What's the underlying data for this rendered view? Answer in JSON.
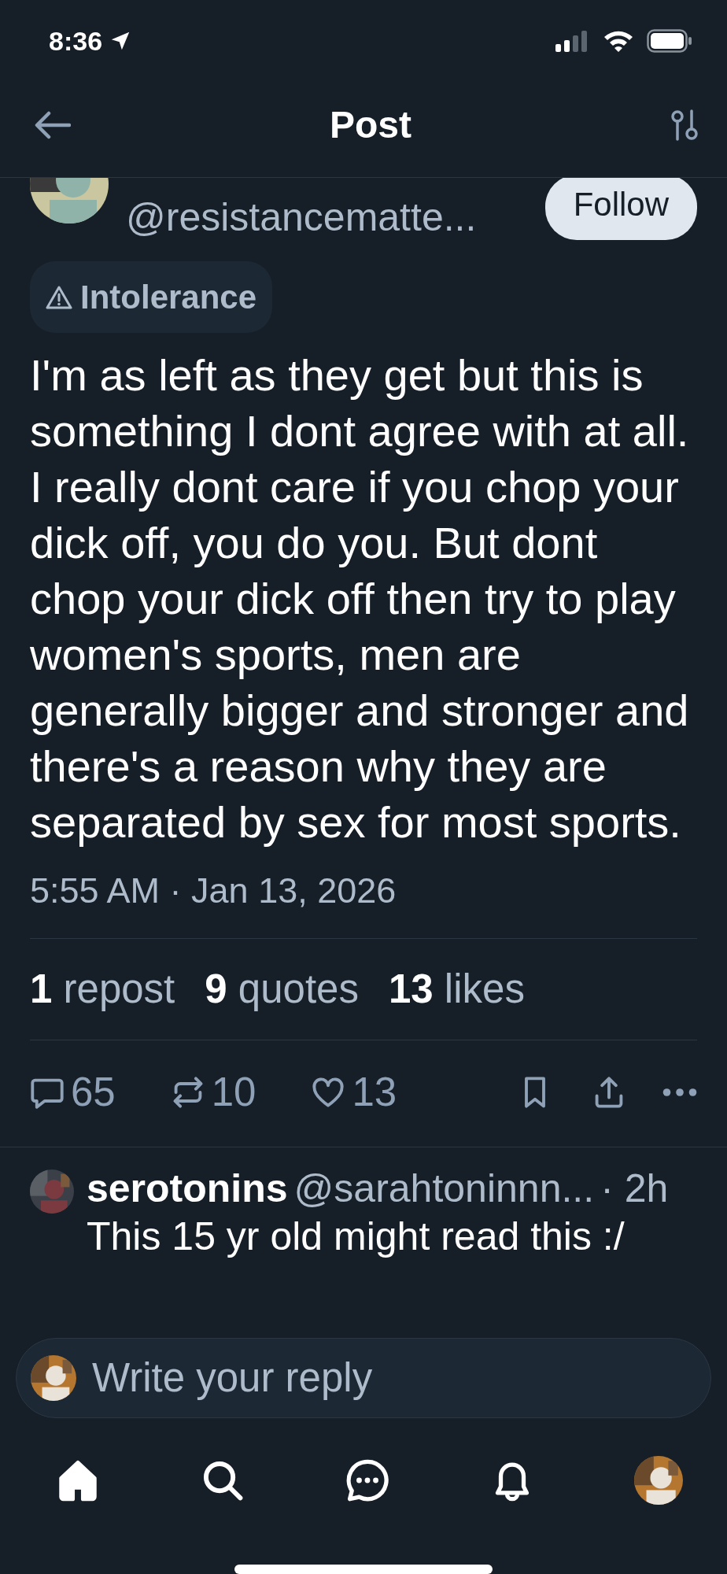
{
  "status_bar": {
    "time": "8:36"
  },
  "header": {
    "title": "Post"
  },
  "post": {
    "handle": "@resistancematte...",
    "follow_label": "Follow",
    "label": {
      "text": "Intolerance"
    },
    "text": "I'm as left as they get but this is something I dont agree with at all. I really dont care if you chop your dick off, you do you. But dont chop your dick off then try to play women's sports, men are generally bigger and stronger and there's a reason why they are separated by sex for most sports.",
    "timestamp": "5:55 AM · Jan 13, 2026",
    "stats": [
      {
        "count": "1",
        "label": "repost"
      },
      {
        "count": "9",
        "label": "quotes"
      },
      {
        "count": "13",
        "label": "likes"
      }
    ],
    "actions": [
      {
        "kind": "reply",
        "count": "65"
      },
      {
        "kind": "repost",
        "count": "10"
      },
      {
        "kind": "like",
        "count": "13"
      },
      {
        "kind": "bookmark"
      },
      {
        "kind": "share"
      },
      {
        "kind": "more"
      }
    ]
  },
  "replies": [
    {
      "name": "serotonins",
      "handle": "@sarahtoninnn...",
      "time": "· 2h",
      "text": "This 15 yr old might read this :/"
    }
  ],
  "reply_box": {
    "placeholder": "Write your reply"
  },
  "nav": [
    {
      "kind": "home",
      "selected": true
    },
    {
      "kind": "search",
      "selected": false
    },
    {
      "kind": "chat",
      "selected": false
    },
    {
      "kind": "notifications",
      "selected": false
    },
    {
      "kind": "profile",
      "selected": false
    }
  ]
}
